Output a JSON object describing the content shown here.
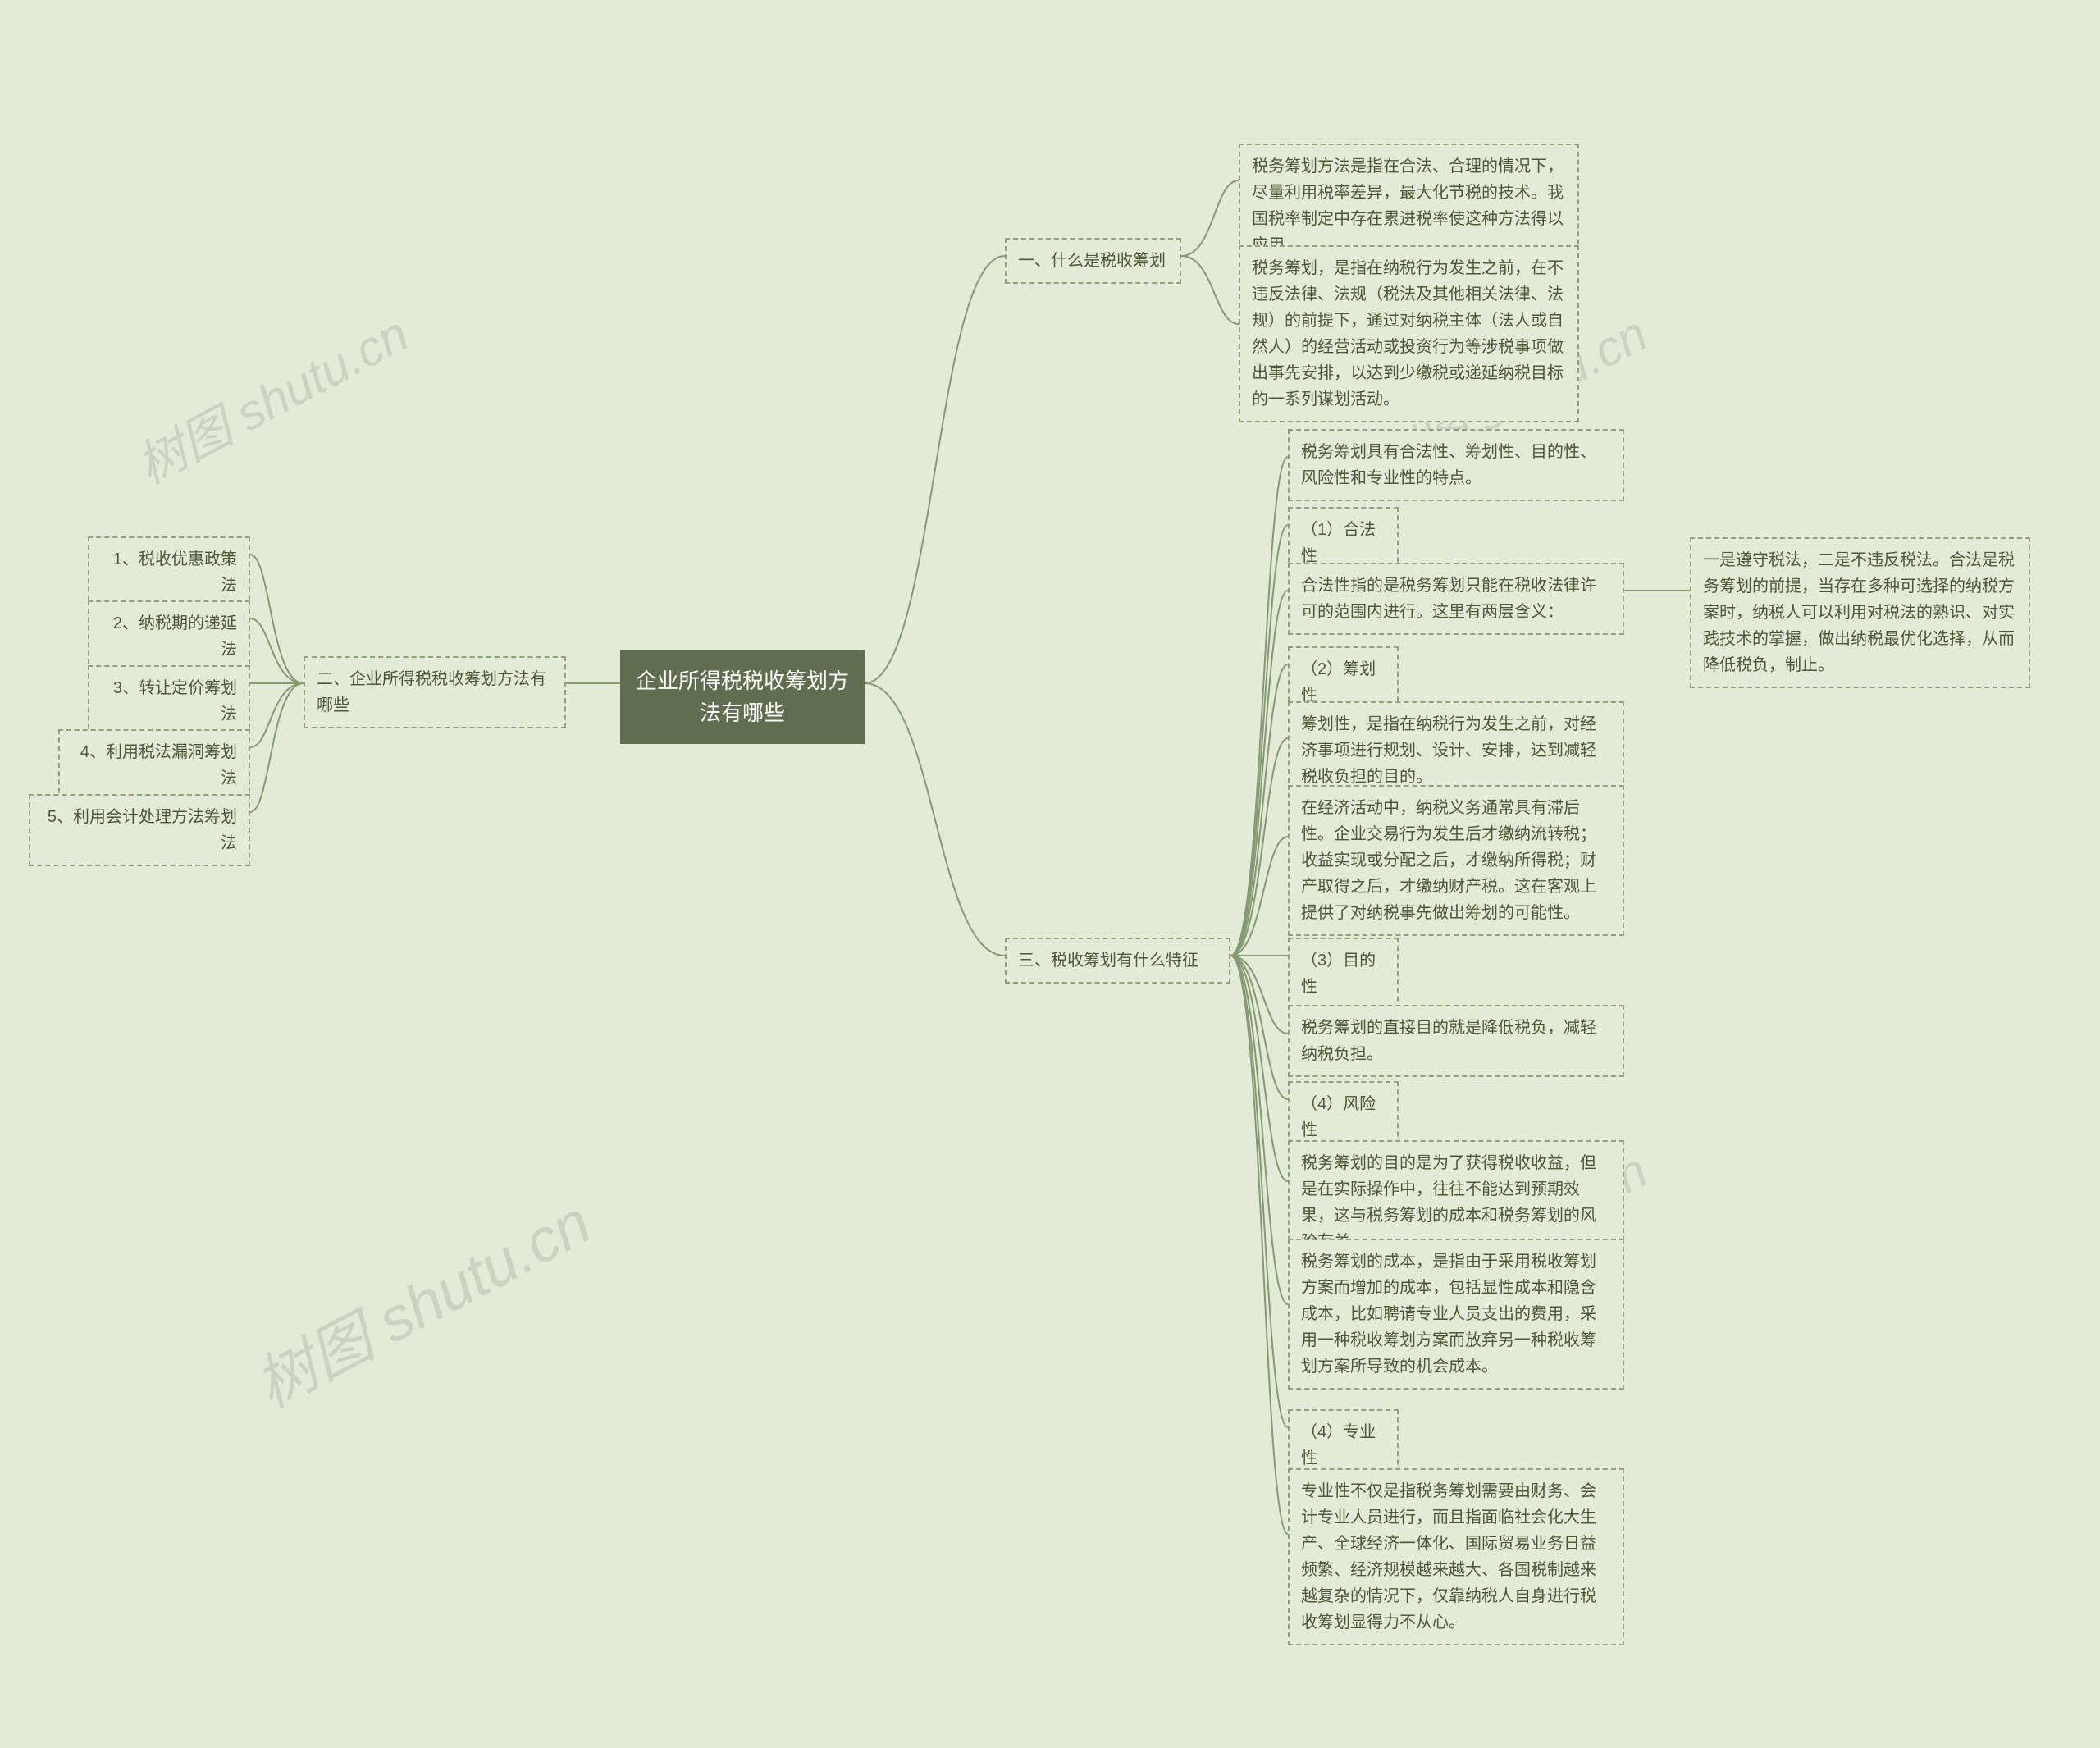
{
  "root": "企业所得税税收筹划方法有哪些",
  "branch1": {
    "title": "一、什么是税收筹划",
    "n1": "税务筹划方法是指在合法、合理的情况下，尽量利用税率差异，最大化节税的技术。我国税率制定中存在累进税率使这种方法得以应用。",
    "n2": "税务筹划，是指在纳税行为发生之前，在不违反法律、法规（税法及其他相关法律、法规）的前提下，通过对纳税主体（法人或自然人）的经营活动或投资行为等涉税事项做出事先安排，以达到少缴税或递延纳税目标的一系列谋划活动。"
  },
  "branch2": {
    "title": "二、企业所得税税收筹划方法有哪些",
    "items": [
      "1、税收优惠政策法",
      "2、纳税期的递延法",
      "3、转让定价筹划法",
      "4、利用税法漏洞筹划法",
      "5、利用会计处理方法筹划法"
    ]
  },
  "branch3": {
    "title": "三、税收筹划有什么特征",
    "n1": "税务筹划具有合法性、筹划性、目的性、风险性和专业性的特点。",
    "n2": "（1）合法性",
    "n3": "合法性指的是税务筹划只能在税收法律许可的范围内进行。这里有两层含义：",
    "n3a": "一是遵守税法，二是不违反税法。合法是税务筹划的前提，当存在多种可选择的纳税方案时，纳税人可以利用对税法的熟识、对实践技术的掌握，做出纳税最优化选择，从而降低税负，制止。",
    "n4": "（2）筹划性",
    "n5": "筹划性，是指在纳税行为发生之前，对经济事项进行规划、设计、安排，达到减轻税收负担的目的。",
    "n6": "在经济活动中，纳税义务通常具有滞后性。企业交易行为发生后才缴纳流转税；收益实现或分配之后，才缴纳所得税；财产取得之后，才缴纳财产税。这在客观上提供了对纳税事先做出筹划的可能性。",
    "n7": "（3）目的性",
    "n8": "税务筹划的直接目的就是降低税负，减轻纳税负担。",
    "n9": "（4）风险性",
    "n10": "税务筹划的目的是为了获得税收收益，但是在实际操作中，往往不能达到预期效果，这与税务筹划的成本和税务筹划的风险有关。",
    "n11": "税务筹划的成本，是指由于采用税收筹划方案而增加的成本，包括显性成本和隐含成本，比如聘请专业人员支出的费用，采用一种税收筹划方案而放弃另一种税收筹划方案所导致的机会成本。",
    "n12": "（4）专业性",
    "n13": "专业性不仅是指税务筹划需要由财务、会计专业人员进行，而且指面临社会化大生产、全球经济一体化、国际贸易业务日益频繁、经济规模越来越大、各国税制越来越复杂的情况下，仅靠纳税人自身进行税收筹划显得力不从心。"
  },
  "watermark": "树图 shutu.cn"
}
